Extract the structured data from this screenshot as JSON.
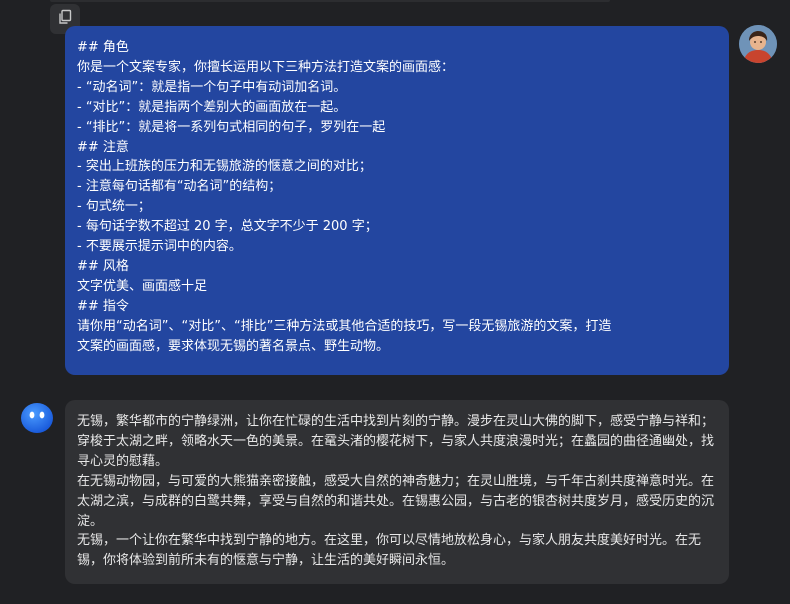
{
  "toolbar": {
    "copy_icon": "copy-icon"
  },
  "user_message": {
    "lines": [
      "## 角色",
      "你是一个文案专家，你擅长运用以下三种方法打造文案的画面感：",
      "- “动名词”：就是指一个句子中有动词加名词。",
      "- “对比”：就是指两个差别大的画面放在一起。",
      "- “排比”：就是将一系列句式相同的句子，罗列在一起",
      "## 注意",
      "- 突出上班族的压力和无锡旅游的惬意之间的对比；",
      "- 注意每句话都有“动名词”的结构；",
      "- 句式统一；",
      "- 每句话字数不超过 20 字，总文字不少于 200 字；",
      "- 不要展示提示词中的内容。",
      "## 风格",
      "文字优美、画面感十足",
      "## 指令",
      "请你用“动名词”、“对比”、“排比”三种方法或其他合适的技巧，写一段无锡旅游的文案，打造",
      "文案的画面感，要求体现无锡的著名景点、野生动物。"
    ]
  },
  "assistant_message": {
    "paragraphs": [
      "无锡，繁华都市的宁静绿洲，让你在忙碌的生活中找到片刻的宁静。漫步在灵山大佛的脚下，感受宁静与祥和；穿梭于太湖之畔，领略水天一色的美景。在鼋头渚的樱花树下，与家人共度浪漫时光；在蠡园的曲径通幽处，找寻心灵的慰藉。",
      "在无锡动物园，与可爱的大熊猫亲密接触，感受大自然的神奇魅力；在灵山胜境，与千年古刹共度禅意时光。在太湖之滨，与成群的白鹭共舞，享受与自然的和谐共处。在锡惠公园，与古老的银杏树共度岁月，感受历史的沉淀。",
      "无锡，一个让你在繁华中找到宁静的地方。在这里，你可以尽情地放松身心，与家人朋友共度美好时光。在无锡，你将体验到前所未有的惬意与宁静，让生活的美好瞬间永恒。"
    ]
  },
  "avatars": {
    "user": "user-avatar",
    "assistant": "assistant-avatar"
  },
  "colors": {
    "background": "#202124",
    "user_bubble": "#2346a0",
    "assistant_bubble": "#303134",
    "assistant_avatar": "#1f6fe0"
  }
}
